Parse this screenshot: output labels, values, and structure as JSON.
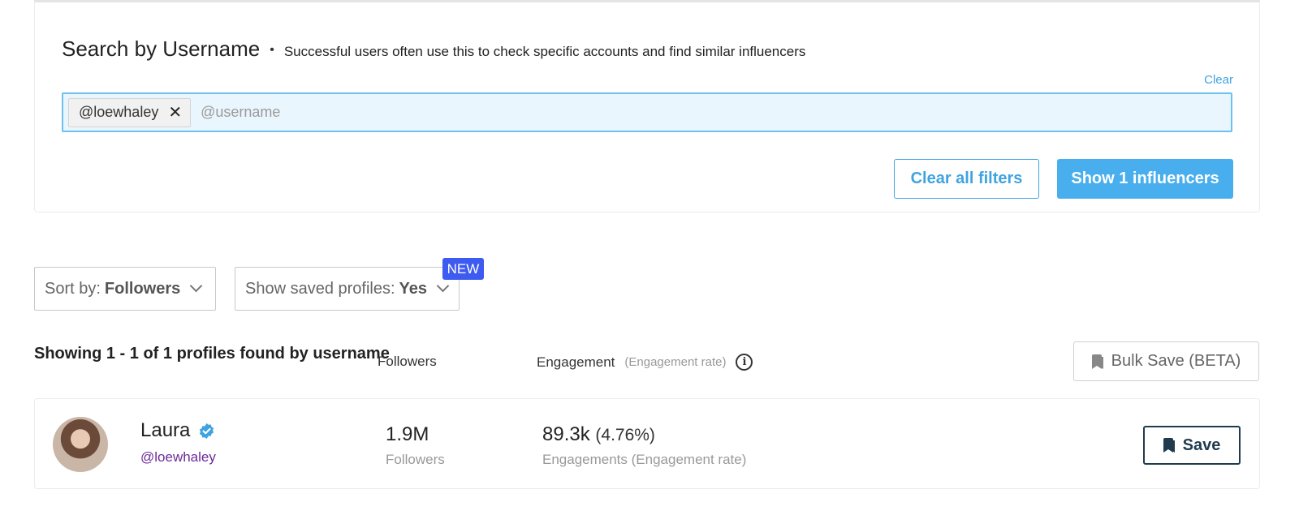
{
  "search": {
    "title": "Search by Username",
    "separator": "•",
    "hint": "Successful users often use this to check specific accounts and find similar influencers",
    "clear_label": "Clear",
    "chip_label": "@loewhaley",
    "chip_remove": "✕",
    "placeholder": "@username",
    "clear_all_label": "Clear all filters",
    "show_label": "Show 1 influencers"
  },
  "controls": {
    "sort_prefix": "Sort by:",
    "sort_value": "Followers",
    "saved_prefix": "Show saved profiles:",
    "saved_value": "Yes",
    "new_badge": "NEW"
  },
  "results": {
    "summary": "Showing 1 - 1 of 1 profiles found by username",
    "col_followers": "Followers",
    "col_engagement": "Engagement",
    "col_engagement_sub": "(Engagement rate)",
    "info_glyph": "i",
    "bulk_save_label": "Bulk Save (BETA)"
  },
  "profile": {
    "name": "Laura",
    "handle": "@loewhaley",
    "followers_value": "1.9M",
    "followers_label": "Followers",
    "engagement_value": "89.3k",
    "engagement_rate": "(4.76%)",
    "engagement_label": "Engagements (Engagement rate)",
    "save_label": "Save"
  },
  "colors": {
    "accent": "#48aeee",
    "verified": "#3fa3e0",
    "badge": "#3d5af1",
    "handle": "#6b2a98",
    "save_border": "#1f3b4d"
  },
  "icons": [
    "close-icon",
    "chevron-down-icon",
    "info-icon",
    "bookmark-icon",
    "verified-icon"
  ]
}
